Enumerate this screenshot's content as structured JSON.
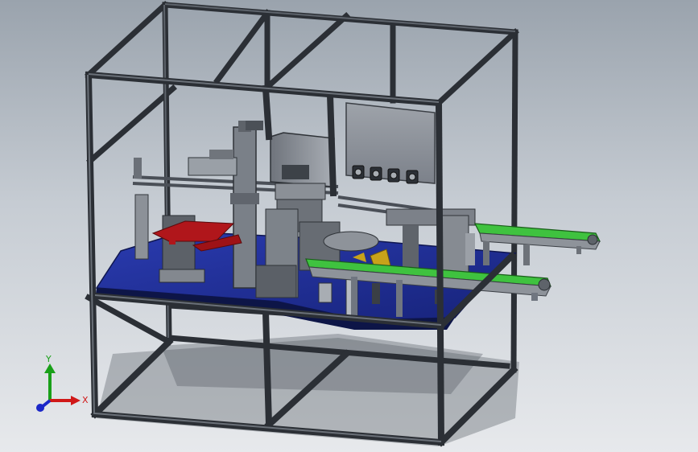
{
  "viewport": {
    "model": "assembly-machine-frame",
    "colors": {
      "background_top": "#9aa3ad",
      "background_bottom": "#e7e9ec",
      "frame": "#2b2f35",
      "base_plate": "#1e2d8f",
      "conveyor_belt": "#3fc23f",
      "red_parts": "#b0161b",
      "yellow_parts": "#c8a21a",
      "panel": "#8a8f96"
    }
  },
  "triad": {
    "x_label": "X",
    "y_label": "Y",
    "x_color": "#d01818",
    "y_color": "#19a019",
    "z_color": "#1b27c8"
  }
}
